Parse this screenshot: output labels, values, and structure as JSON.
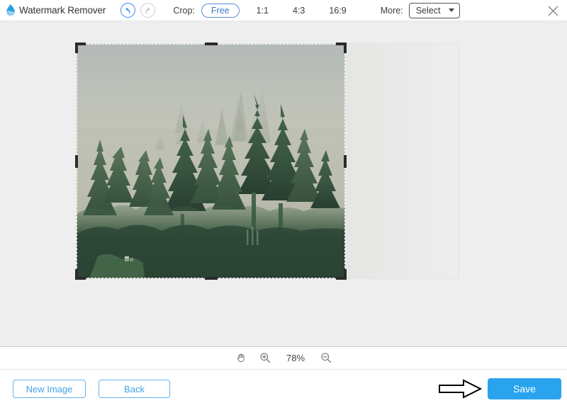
{
  "app": {
    "title": "Watermark Remover",
    "logo_icon": "water-drop-icon",
    "accent_blue": "#29a3ee",
    "toolbar_blue": "#3b78c8"
  },
  "header": {
    "undo_icon": "undo-arrow-icon",
    "redo_icon": "redo-arrow-icon",
    "crop_label": "Crop:",
    "ratios": [
      {
        "label": "Free",
        "selected": true
      },
      {
        "label": "1:1",
        "selected": false
      },
      {
        "label": "4:3",
        "selected": false
      },
      {
        "label": "16:9",
        "selected": false
      }
    ],
    "more_label": "More:",
    "more_select_value": "Select",
    "more_caret_icon": "chevron-down-icon",
    "close_icon": "close-icon"
  },
  "canvas": {
    "image_description": "Misty forest with evergreen pine trees and fog",
    "crop_overlay": {
      "corner_handle_icon": "crop-corner-handle",
      "edge_handle_icon": "crop-edge-handle"
    }
  },
  "zoombar": {
    "hand_icon": "hand-tool-icon",
    "zoom_in_icon": "zoom-in-icon",
    "zoom_level": "78%",
    "zoom_out_icon": "zoom-out-icon"
  },
  "footer": {
    "new_image_label": "New Image",
    "back_label": "Back",
    "save_label": "Save",
    "pointer_icon": "right-arrow-annotation"
  }
}
